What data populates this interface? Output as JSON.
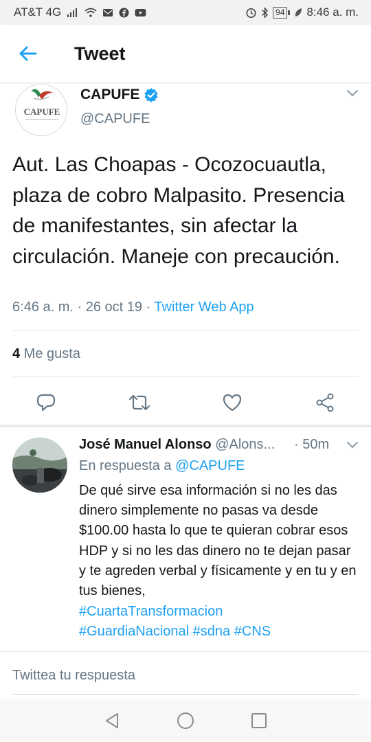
{
  "status_bar": {
    "carrier": "AT&T 4G",
    "battery": "94",
    "time": "8:46 a. m."
  },
  "header": {
    "title": "Tweet"
  },
  "tweet": {
    "author_name": "CAPUFE",
    "author_handle": "@CAPUFE",
    "avatar_logo_text": "CAPUFE",
    "text": "Aut. Las Choapas - Ocozocuautla, plaza de cobro Malpasito. Presencia de manifestantes, sin afectar la circulación. Maneje con precaución.",
    "timestamp": "6:46 a. m. · 26 oct 19 · ",
    "source": "Twitter Web App",
    "likes_count": "4",
    "likes_label": " Me gusta"
  },
  "reply": {
    "author_name": "José Manuel Alonso",
    "author_handle": " @Alons...",
    "time": "· 50m",
    "replying_prefix": "En respuesta a ",
    "replying_to": "@CAPUFE",
    "text": "De qué sirve esa información si no les das dinero simplemente no pasas va desde $100.00 hasta lo que te quieran cobrar esos HDP y si no les das dinero no te dejan pasar y te agreden verbal y físicamente y en tu y en tus bienes,",
    "hashtag_line1": "#CuartaTransformacion",
    "hashtag_line2": "#GuardiaNacional #sdna #CNS"
  },
  "composer": {
    "placeholder": "Twittea tu respuesta"
  },
  "colors": {
    "accent": "#1da1f2",
    "secondary_text": "#657786",
    "primary_text": "#14171a"
  }
}
